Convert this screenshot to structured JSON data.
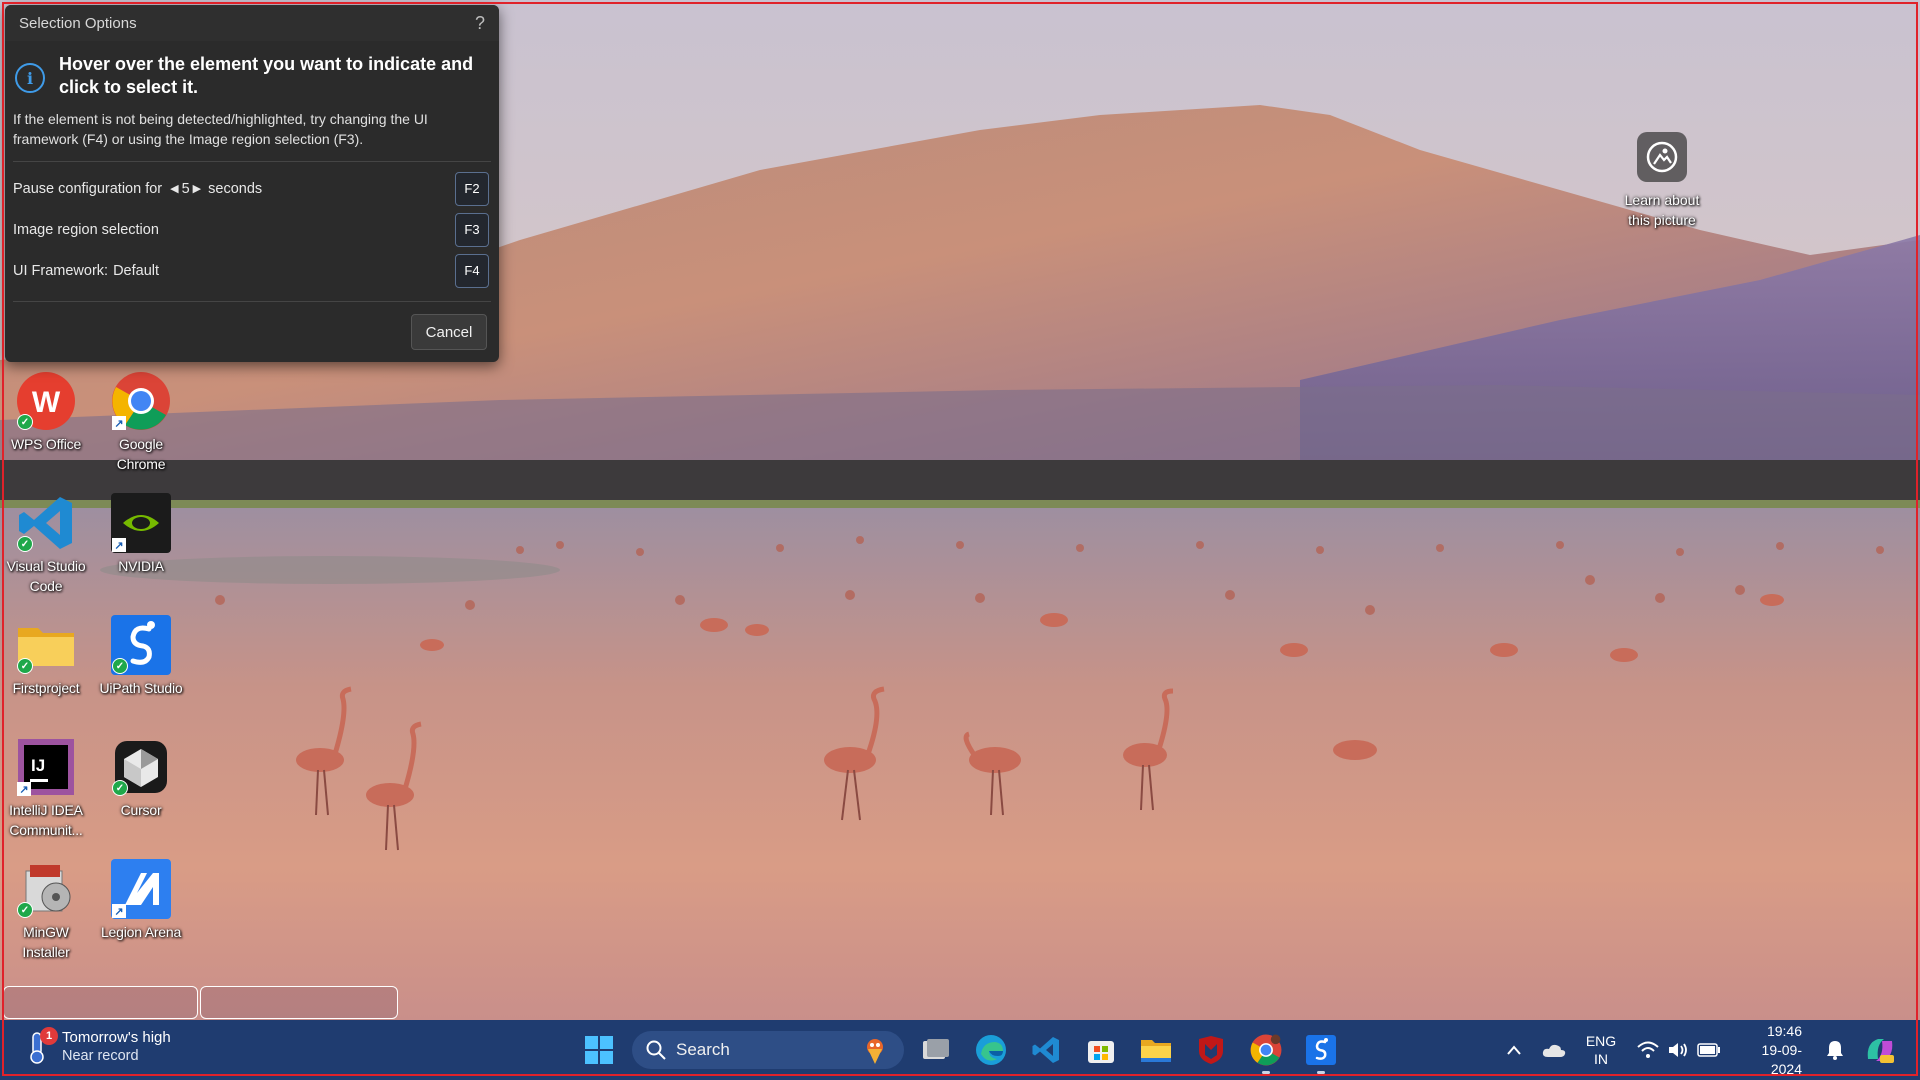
{
  "dialog": {
    "title": "Selection Options",
    "help_label": "?",
    "info_title": "Hover over the element you want to indicate and click to select it.",
    "info_desc": "If the element is not being detected/highlighted, try changing the UI framework (F4) or using the Image region selection (F3).",
    "options": [
      {
        "label": "Pause configuration for",
        "value": "5",
        "suffix": "seconds",
        "key": "F2"
      },
      {
        "label": "Image region selection",
        "key": "F3"
      },
      {
        "label": "UI Framework:",
        "value": "Default",
        "key": "F4"
      }
    ],
    "cancel_label": "Cancel"
  },
  "desktop": {
    "learn_label": "Learn about this picture",
    "icons": [
      {
        "name": "WPS Office",
        "icon": "wps-office-icon"
      },
      {
        "name": "Google Chrome",
        "icon": "chrome-icon"
      },
      {
        "name": "Visual Studio Code",
        "icon": "vscode-icon"
      },
      {
        "name": "NVIDIA",
        "icon": "nvidia-icon"
      },
      {
        "name": "Firstproject",
        "icon": "folder-icon"
      },
      {
        "name": "UiPath Studio",
        "icon": "uipath-icon"
      },
      {
        "name": "IntelliJ IDEA Communit...",
        "icon": "intellij-icon"
      },
      {
        "name": "Cursor",
        "icon": "cursor-icon"
      },
      {
        "name": "MinGW Installer",
        "icon": "mingw-icon"
      },
      {
        "name": "Legion Arena",
        "icon": "legion-arena-icon"
      }
    ]
  },
  "taskbar": {
    "weather_title": "Tomorrow's high",
    "weather_sub": "Near record",
    "weather_badge": "1",
    "search_placeholder": "Search",
    "apps": [
      "start-icon",
      "task-view-icon",
      "edge-icon",
      "vscode-icon",
      "store-icon",
      "file-explorer-icon",
      "mcafee-icon",
      "chrome-icon",
      "uipath-icon"
    ],
    "lang_line1": "ENG",
    "lang_line2": "IN",
    "time": "19:46",
    "date": "19-09-2024"
  },
  "colors": {
    "taskbar": "#1f3c70",
    "dialog_bg": "#2b2b2b",
    "accent_info": "#3f9be8",
    "frame_red": "#e0222a"
  }
}
